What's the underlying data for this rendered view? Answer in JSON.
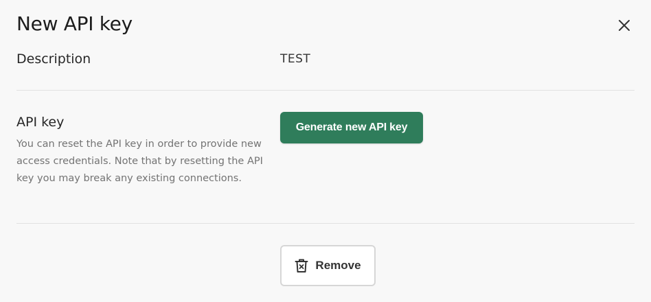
{
  "dialog": {
    "title": "New API key"
  },
  "description": {
    "label": "Description",
    "value": "TEST"
  },
  "api_key": {
    "label": "API key",
    "help_text": "You can reset the API key in order to provide new access credentials. Note that by resetting the API key you may break any existing connections.",
    "generate_label": "Generate new API key"
  },
  "actions": {
    "remove_label": "Remove"
  },
  "icons": {
    "close": "close-icon",
    "remove": "trash-icon"
  },
  "colors": {
    "primary": "#2f7d5b",
    "background": "#f8f8f8"
  }
}
